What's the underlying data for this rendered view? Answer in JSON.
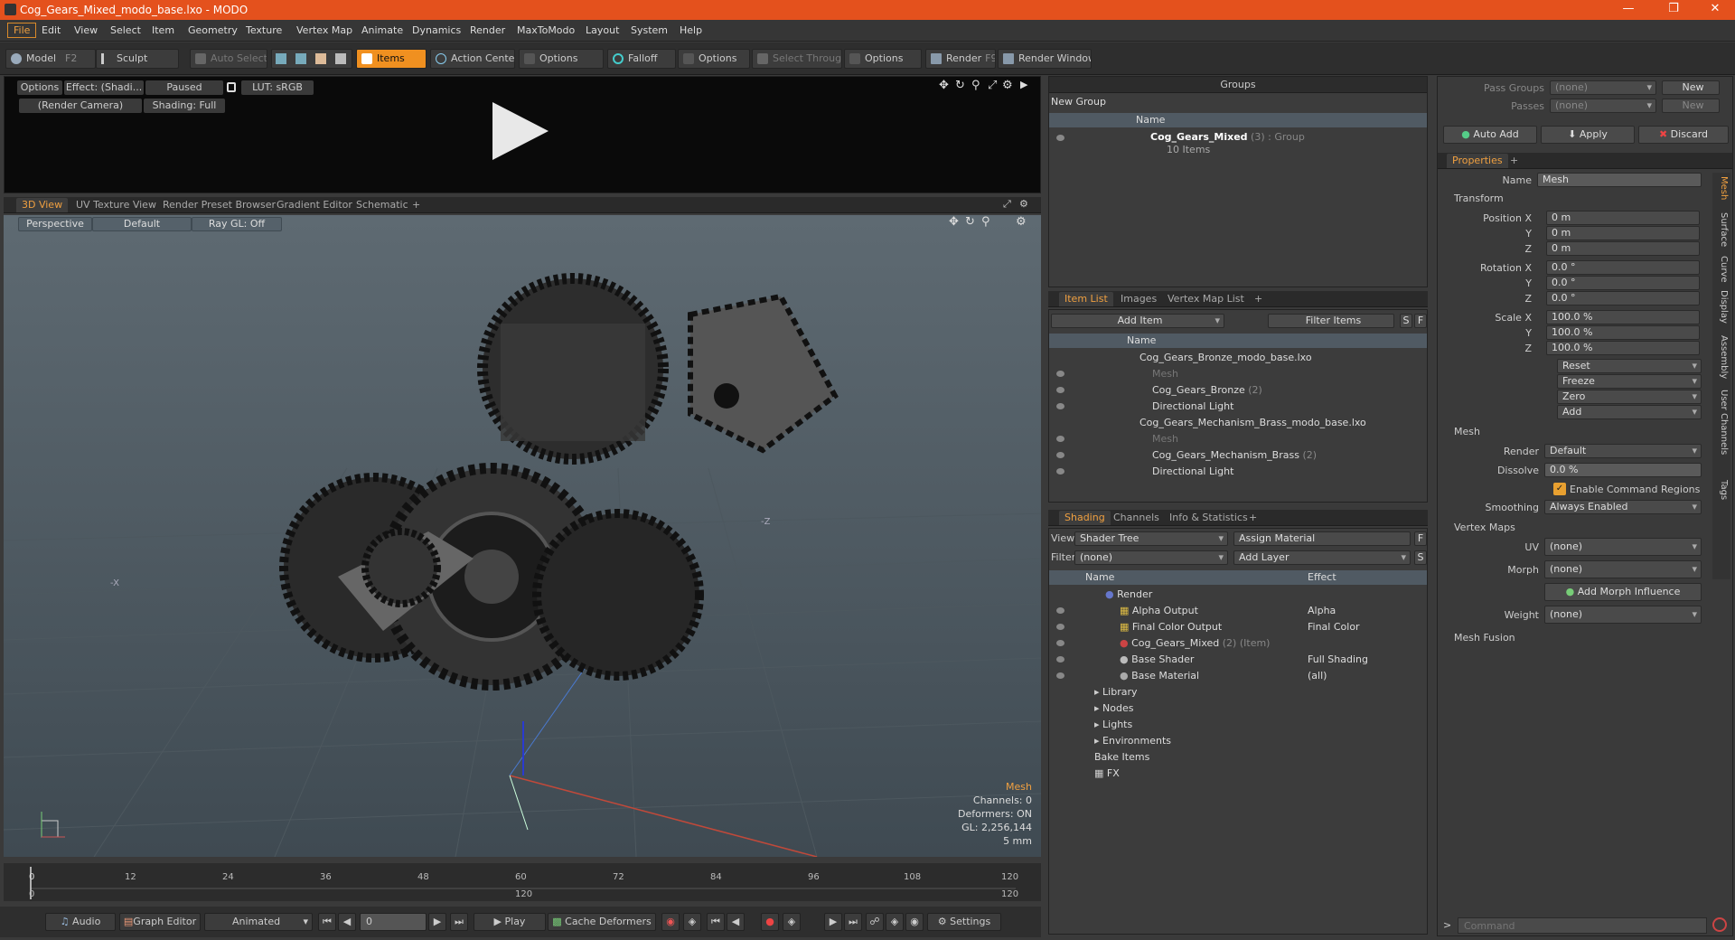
{
  "window": {
    "title": "Cog_Gears_Mixed_modo_base.lxo - MODO"
  },
  "menu": [
    "File",
    "Edit",
    "View",
    "Select",
    "Item",
    "Geometry",
    "Texture",
    "Vertex Map",
    "Animate",
    "Dynamics",
    "Render",
    "MaxToModo",
    "Layout",
    "System",
    "Help"
  ],
  "toolbar": {
    "model": "Model",
    "model_key": "F2",
    "sculpt": "Sculpt",
    "auto_select": "Auto Select",
    "items": "Items",
    "action_center": "Action Center",
    "options1": "Options",
    "falloff": "Falloff",
    "options2": "Options",
    "select_through": "Select Through",
    "options3": "Options",
    "render": "Render",
    "render_key": "F9",
    "render_window": "Render Window"
  },
  "render_preview": {
    "options": "Options",
    "effect": "Effect: (Shadi...",
    "paused": "Paused",
    "lut": "LUT: sRGB",
    "camera": "(Render Camera)",
    "shading": "Shading: Full"
  },
  "view_tabs": [
    "3D View",
    "UV Texture View",
    "Render Preset Browser",
    "Gradient Editor",
    "Schematic"
  ],
  "viewport": {
    "perspective": "Perspective",
    "default": "Default",
    "raygl": "Ray GL: Off",
    "axis_x": "-X",
    "axis_z": "-Z",
    "info_title": "Mesh",
    "channels": "Channels: 0",
    "deformers": "Deformers: ON",
    "gl": "GL: 2,256,144",
    "unit": "5 mm"
  },
  "timeline": {
    "ticks": [
      "0",
      "12",
      "24",
      "36",
      "48",
      "60",
      "72",
      "84",
      "96",
      "108",
      "120"
    ],
    "end_left": "0",
    "end_mid": "120",
    "end_right": "120"
  },
  "transport": {
    "audio": "Audio",
    "graph_editor": "Graph Editor",
    "animated": "Animated",
    "frame": "0",
    "play": "Play",
    "cache_deformers": "Cache Deformers",
    "settings": "Settings"
  },
  "groups": {
    "title": "Groups",
    "new_group": "New Group",
    "col_name": "Name",
    "item_name": "Cog_Gears_Mixed",
    "item_count": "(3)",
    "item_type": ": Group",
    "item_sub": "10 Items"
  },
  "item_list": {
    "tabs": [
      "Item List",
      "Images",
      "Vertex Map List"
    ],
    "add_item": "Add Item",
    "filter_items": "Filter Items",
    "s": "S",
    "f": "F",
    "col_name": "Name",
    "rows": [
      {
        "label": "Cog_Gears_Bronze_modo_base.lxo",
        "extra": ""
      },
      {
        "label": "Mesh",
        "extra": ""
      },
      {
        "label": "Cog_Gears_Bronze",
        "extra": "(2)"
      },
      {
        "label": "Directional Light",
        "extra": ""
      },
      {
        "label": "Cog_Gears_Mechanism_Brass_modo_base.lxo",
        "extra": ""
      },
      {
        "label": "Mesh",
        "extra": ""
      },
      {
        "label": "Cog_Gears_Mechanism_Brass",
        "extra": "(2)"
      },
      {
        "label": "Directional Light",
        "extra": ""
      }
    ]
  },
  "shading": {
    "tabs": [
      "Shading",
      "Channels",
      "Info & Statistics"
    ],
    "view_label": "View",
    "view_value": "Shader Tree",
    "assign_material": "Assign Material",
    "f": "F",
    "filter_label": "Filter",
    "filter_value": "(none)",
    "add_layer": "Add Layer",
    "s": "S",
    "col_name": "Name",
    "col_effect": "Effect",
    "rows": [
      {
        "name": "Render",
        "extra": "",
        "effect": ""
      },
      {
        "name": "Alpha Output",
        "extra": "",
        "effect": "Alpha"
      },
      {
        "name": "Final Color Output",
        "extra": "",
        "effect": "Final Color"
      },
      {
        "name": "Cog_Gears_Mixed",
        "extra": "(2) (Item)",
        "effect": ""
      },
      {
        "name": "Base Shader",
        "extra": "",
        "effect": "Full Shading"
      },
      {
        "name": "Base Material",
        "extra": "",
        "effect": "(all)"
      },
      {
        "name": "Library",
        "extra": "",
        "effect": ""
      },
      {
        "name": "Nodes",
        "extra": "",
        "effect": ""
      },
      {
        "name": "Lights",
        "extra": "",
        "effect": ""
      },
      {
        "name": "Environments",
        "extra": "",
        "effect": ""
      },
      {
        "name": "Bake Items",
        "extra": "",
        "effect": ""
      },
      {
        "name": "FX",
        "extra": "",
        "effect": ""
      }
    ]
  },
  "pass": {
    "pass_groups": "Pass Groups",
    "passes": "Passes",
    "none1": "(none)",
    "none2": "(none)",
    "new1": "New",
    "new2": "New",
    "auto_add": "Auto Add",
    "apply": "Apply",
    "discard": "Discard"
  },
  "properties": {
    "tab": "Properties",
    "name_label": "Name",
    "name_value": "Mesh",
    "transform": "Transform",
    "pos_label": "Position X",
    "y": "Y",
    "z": "Z",
    "pos": [
      "0 m",
      "0 m",
      "0 m"
    ],
    "rot_label": "Rotation X",
    "rot": [
      "0.0 °",
      "0.0 °",
      "0.0 °"
    ],
    "scale_label": "Scale X",
    "scale": [
      "100.0 %",
      "100.0 %",
      "100.0 %"
    ],
    "reset": "Reset",
    "freeze": "Freeze",
    "zero": "Zero",
    "add": "Add",
    "mesh": "Mesh",
    "render_label": "Render",
    "render_value": "Default",
    "dissolve_label": "Dissolve",
    "dissolve_value": "0.0 %",
    "enable_cmd": "Enable Command Regions",
    "smoothing_label": "Smoothing",
    "smoothing_value": "Always Enabled",
    "vertex_maps": "Vertex Maps",
    "uv_label": "UV",
    "uv_value": "(none)",
    "morph_label": "Morph",
    "morph_value": "(none)",
    "add_morph": "Add Morph Influence",
    "weight_label": "Weight",
    "weight_value": "(none)",
    "mesh_fusion": "Mesh Fusion",
    "side_tabs": [
      "Mesh",
      "Surface",
      "Curve",
      "Display",
      "Assembly",
      "User Channels",
      "Tags"
    ]
  },
  "command": {
    "placeholder": "Command"
  }
}
